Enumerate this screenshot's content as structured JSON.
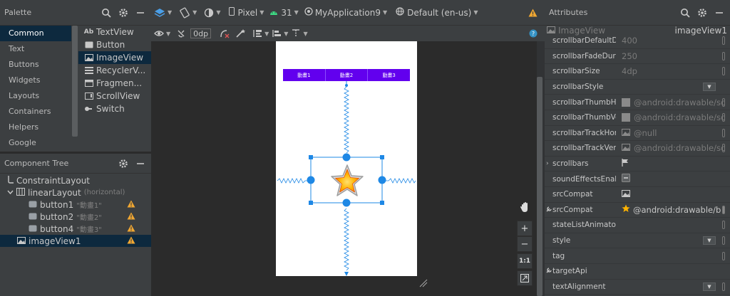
{
  "palette": {
    "title": "Palette",
    "categories": [
      "Common",
      "Text",
      "Buttons",
      "Widgets",
      "Layouts",
      "Containers",
      "Helpers",
      "Google"
    ],
    "items": [
      {
        "icon": "text-icon",
        "label": "TextView"
      },
      {
        "icon": "button-icon",
        "label": "Button"
      },
      {
        "icon": "image-icon",
        "label": "ImageView"
      },
      {
        "icon": "list-icon",
        "label": "RecyclerV..."
      },
      {
        "icon": "fragment-icon",
        "label": "Fragmen..."
      },
      {
        "icon": "scrollview-icon",
        "label": "ScrollView"
      },
      {
        "icon": "switch-icon",
        "label": "Switch"
      }
    ],
    "text_icon_glyph": "Ab"
  },
  "tree": {
    "title": "Component Tree",
    "root": "ConstraintLayout",
    "linear": {
      "label": "linearLayout",
      "sub": "(horizontal)"
    },
    "buttons": [
      {
        "label": "button1",
        "sub": "\"動畫1\""
      },
      {
        "label": "button2",
        "sub": "\"動畫2\""
      },
      {
        "label": "button4",
        "sub": "\"動畫3\""
      }
    ],
    "image": "imageView1"
  },
  "toolbar": {
    "device": "Pixel",
    "api": "31",
    "theme": "MyApplication9",
    "locale": "Default (en-us)",
    "margin": "0dp"
  },
  "preview": {
    "buttons": [
      "動畫1",
      "動畫2",
      "動畫3"
    ],
    "zoom_ratio": "1:1",
    "zoom_in": "+",
    "zoom_out": "−"
  },
  "attributes": {
    "title": "Attributes",
    "component_type": "ImageView",
    "component_id": "imageView1",
    "rows": [
      {
        "name": "scrollbarDefaultDe...",
        "value": "400"
      },
      {
        "name": "scrollbarFadeDura...",
        "value": "250"
      },
      {
        "name": "scrollbarSize",
        "value": "4dp"
      },
      {
        "name": "scrollbarStyle",
        "value": ""
      },
      {
        "name": "scrollbarThumbHo...",
        "value": "@android:drawable/sc"
      },
      {
        "name": "scrollbarThumbVe...",
        "value": "@android:drawable/sc"
      },
      {
        "name": "scrollbarTrackHori...",
        "value": "@null"
      },
      {
        "name": "scrollbarTrackVerti...",
        "value": "@android:drawable/sc"
      },
      {
        "name": "scrollbars",
        "value": ""
      },
      {
        "name": "soundEffectsEnabl...",
        "value": ""
      },
      {
        "name": "srcCompat",
        "value": ""
      },
      {
        "name": "srcCompat",
        "value": "@android:drawable/b"
      },
      {
        "name": "stateListAnimator",
        "value": ""
      },
      {
        "name": "style",
        "value": ""
      },
      {
        "name": "tag",
        "value": ""
      },
      {
        "name": "targetApi",
        "value": ""
      },
      {
        "name": "textAlignment",
        "value": ""
      }
    ]
  },
  "colors": {
    "panel_bg": "#3c3f41",
    "canvas_bg": "#2b2b2b",
    "selection": "#0d293e",
    "accent_blue": "#1e88e5",
    "button_purple": "#6200ee",
    "warning": "#f0a732",
    "star": "#ffb300"
  }
}
